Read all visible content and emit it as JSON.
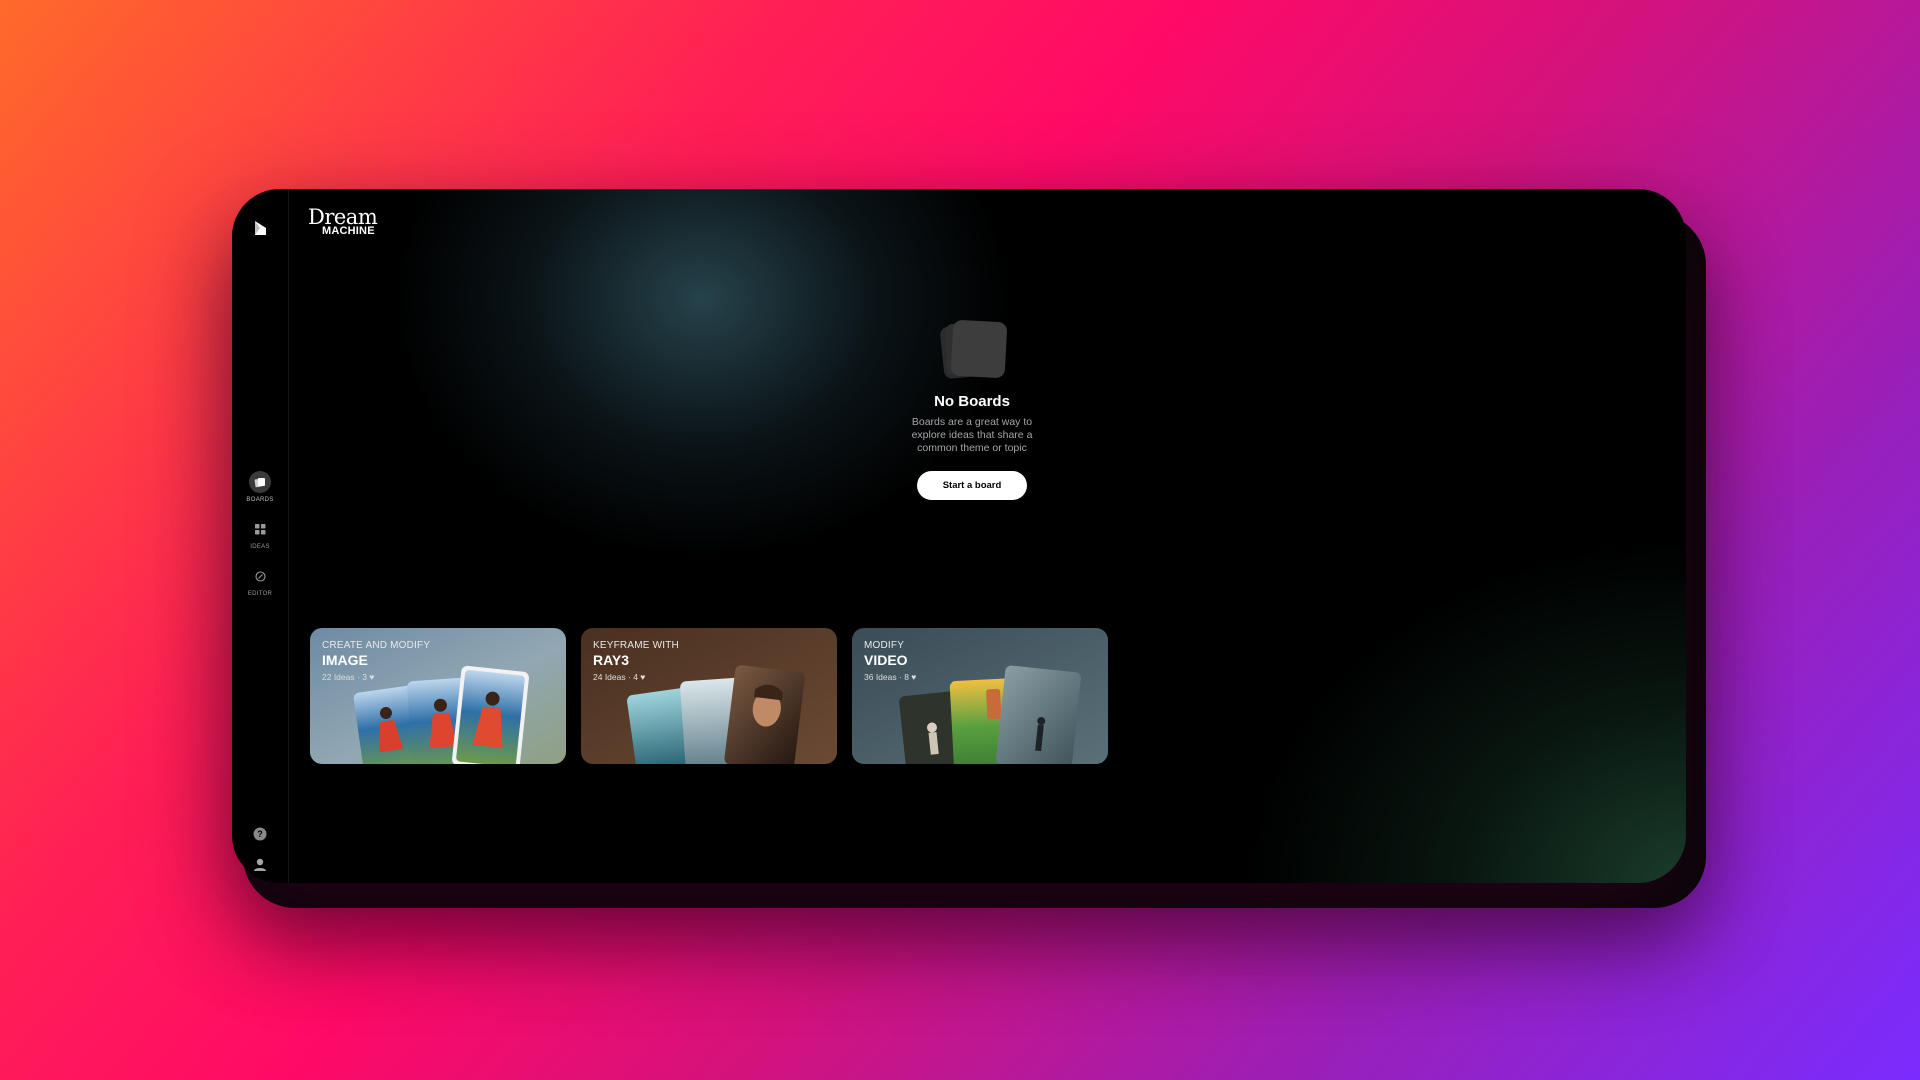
{
  "brand": {
    "line1": "Dream",
    "line2": "MACHINE"
  },
  "nav": [
    {
      "label": "BOARDS",
      "icon": "boards-icon",
      "active": true
    },
    {
      "label": "IDEAS",
      "icon": "grid-icon",
      "active": false
    },
    {
      "label": "EDITOR",
      "icon": "editor-icon",
      "active": false
    }
  ],
  "bottom_icons": [
    "help-icon",
    "profile-icon"
  ],
  "empty_state": {
    "title": "No Boards",
    "description": "Boards are a great way to explore ideas that share a common theme or topic",
    "button": "Start a board"
  },
  "cards": [
    {
      "subtitle": "CREATE AND MODIFY",
      "title": "IMAGE",
      "ideas": "22 Ideas",
      "likes": "3"
    },
    {
      "subtitle": "KEYFRAME WITH",
      "title": "RAY3",
      "ideas": "24 Ideas",
      "likes": "4"
    },
    {
      "subtitle": "MODIFY",
      "title": "VIDEO",
      "ideas": "36 Ideas",
      "likes": "8"
    }
  ],
  "colors": {
    "accent": "#ffffff",
    "background": "#000000"
  }
}
